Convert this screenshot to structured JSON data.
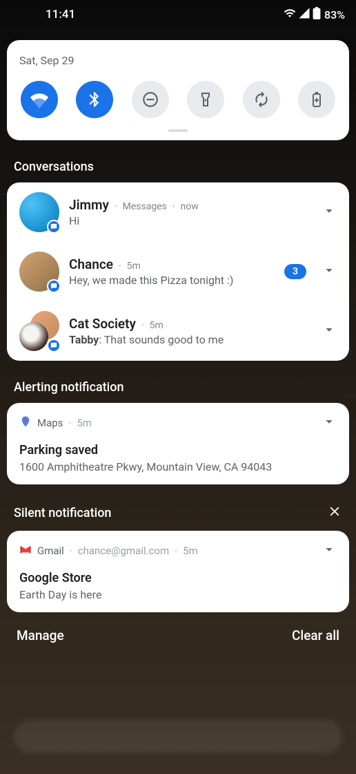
{
  "statusbar": {
    "time": "11:41",
    "battery": "83%"
  },
  "quicksettings": {
    "date": "Sat, Sep 29",
    "tiles": [
      {
        "name": "wifi",
        "active": true
      },
      {
        "name": "bluetooth",
        "active": true
      },
      {
        "name": "dnd",
        "active": false
      },
      {
        "name": "flashlight",
        "active": false
      },
      {
        "name": "autorotate",
        "active": false
      },
      {
        "name": "battery-saver",
        "active": false
      }
    ]
  },
  "sections": {
    "conversations": "Conversations",
    "alerting": "Alerting notification",
    "silent": "Silent notification"
  },
  "conversations": [
    {
      "name": "Jimmy",
      "app": "Messages",
      "time": "now",
      "message": "Hi"
    },
    {
      "name": "Chance",
      "time": "5m",
      "message": "Hey, we made this Pizza tonight :)",
      "count": "3"
    },
    {
      "name": "Cat Society",
      "time": "5m",
      "author": "Tabby",
      "message": "That sounds good to me"
    }
  ],
  "alerting": {
    "app": "Maps",
    "time": "5m",
    "title": "Parking saved",
    "body": "1600 Amphitheatre Pkwy, Mountain View, CA 94043"
  },
  "silent": {
    "app": "Gmail",
    "account": "chance@gmail.com",
    "time": "5m",
    "title": "Google Store",
    "body": "Earth Day is here"
  },
  "footer": {
    "manage": "Manage",
    "clearall": "Clear all"
  },
  "separators": {
    "dot": "·",
    "colon": ": "
  }
}
